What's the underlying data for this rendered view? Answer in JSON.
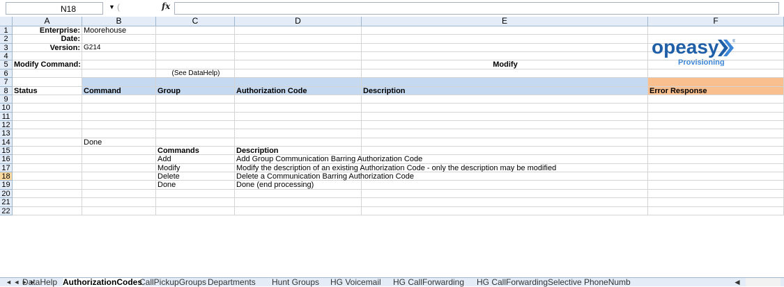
{
  "formula_bar": {
    "name_box": "N18",
    "fx": "fx",
    "formula": ""
  },
  "columns": [
    "A",
    "B",
    "C",
    "D",
    "E",
    "F"
  ],
  "rows": [
    "1",
    "2",
    "3",
    "4",
    "5",
    "6",
    "7",
    "8",
    "9",
    "10",
    "11",
    "12",
    "13",
    "14",
    "15",
    "16",
    "17",
    "18",
    "19",
    "20",
    "21",
    "22"
  ],
  "cells": {
    "A1": "Enterprise:",
    "B1": "Moorehouse",
    "A2": "Date:",
    "A3": "Version:",
    "B3": "G214",
    "A5": "Modify Command:",
    "E5": "Modify",
    "C6": "(See DataHelp)",
    "A8": "Status",
    "B8": "Command",
    "C8": "Group",
    "D8": "Authorization Code",
    "E8": "Description",
    "F8": "Error Response",
    "B14": "Done",
    "C15": "Commands",
    "D15": "Description",
    "C16": "Add",
    "D16": "Add Group Communication Barring Authorization Code",
    "C17": "Modify",
    "D17": "Modify the description of an existing Authorization Code - only the description may be modified",
    "C18": "Delete",
    "D18": "Delete a Communication Barring Authorization Code",
    "C19": "Done",
    "D19": "Done (end processing)"
  },
  "logo": {
    "word": "opeasy",
    "sub": "Provisioning",
    "reg": "®"
  },
  "tabs": {
    "nav": "◄ ◄ ► ►",
    "items": [
      "DataHelp",
      "AuthorizationCodes",
      "CallPickupGroups",
      "Departments",
      "Hunt Groups",
      "HG Voicemail",
      "HG CallForwarding",
      "HG CallForwardingSelective",
      "PhoneNumb"
    ],
    "active": "AuthorizationCodes"
  },
  "colors": {
    "header_blue": "#c5d9f1",
    "header_orange": "#fabf8f",
    "logo_blue": "#1f5fa8"
  }
}
